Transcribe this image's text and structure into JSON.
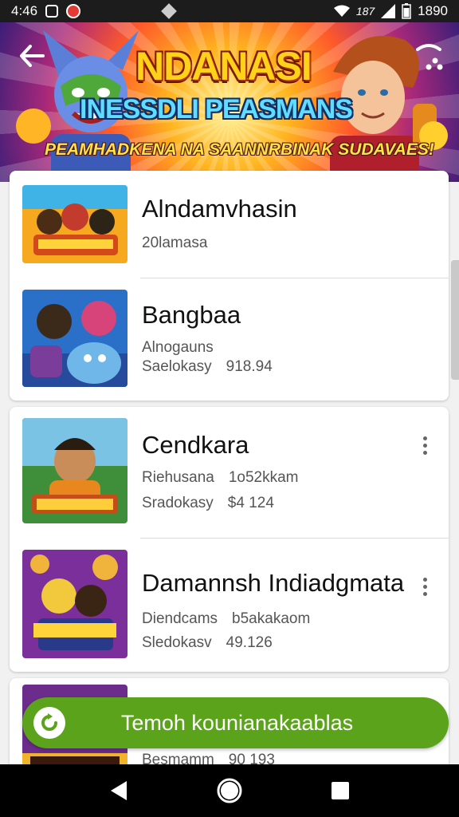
{
  "status_bar": {
    "time": "4:46",
    "network": "187",
    "battery": "1890"
  },
  "banner": {
    "title": "NDANASI",
    "subtitle": "INESSDLI PEASMANS",
    "tagline": "PEAMHADKENA NA SAANNRBINAK SUDAVAES!"
  },
  "list": {
    "items": [
      {
        "title": "Alndamvhasin",
        "line1": "20lamasa",
        "line2_label": "",
        "line2_value": ""
      },
      {
        "title": "Bangbaa",
        "line1": "Alnogauns",
        "line2_label": "Saelokasy",
        "line2_value": "918.94"
      },
      {
        "title": "Cendkara",
        "line1_label": "Riehusana",
        "line1_value": "1o52kkam",
        "line2_label": "Sradokasy",
        "line2_value": "$4 124"
      },
      {
        "title": "Damannsh Indiadgmata",
        "line1_label": "Diendcams",
        "line1_value": "b5akakaom",
        "line2_label": "Sledokasv",
        "line2_value": "49.126"
      },
      {
        "line1_label": "Besmamm",
        "line1_value": "90 193"
      }
    ]
  },
  "action_pill": {
    "label": "Temoh kounianakaablas",
    "color": "#5aa31a"
  },
  "icons": {
    "back": "back-arrow-icon",
    "share": "share-icon",
    "more": "more-vert-icon",
    "nav_back": "nav-back-icon",
    "nav_home": "nav-home-icon",
    "nav_recents": "nav-recents-icon"
  }
}
